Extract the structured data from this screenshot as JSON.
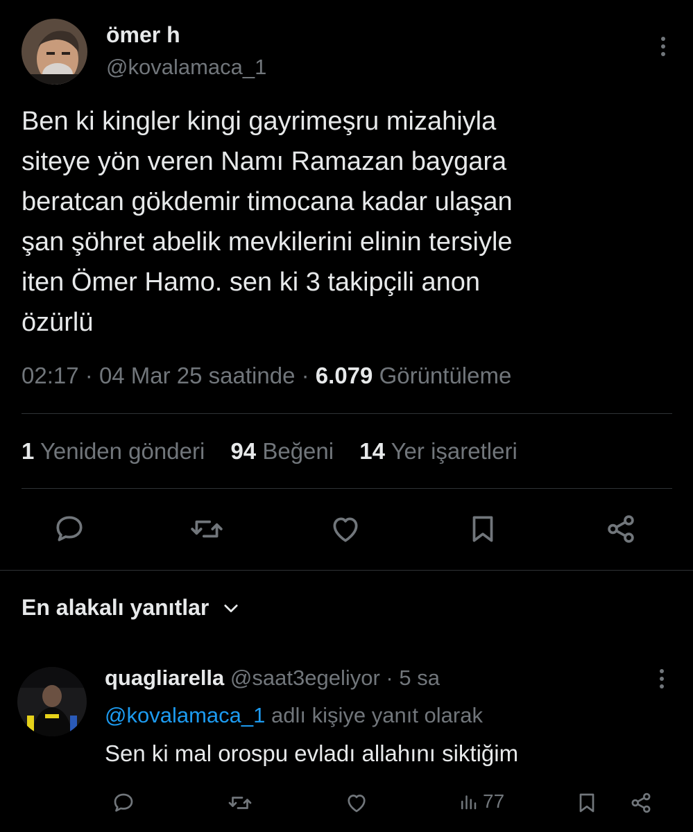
{
  "tweet": {
    "author": {
      "name": "ömer h",
      "handle": "@kovalamaca_1"
    },
    "text": "Ben ki kingler kingi gayrimeşru mizahiyla\nsiteye yön veren Namı Ramazan baygara\nberatcan gökdemir timocana kadar ulaşan\nşan şöhret abelik mevkilerini elinin tersiyle\niten Ömer Hamo. sen ki 3 takipçili anon\nözürlü",
    "time": "02:17",
    "date": "04 Mar 25 saatinde",
    "separator": "·",
    "views_count": "6.079",
    "views_label": "Görüntüleme",
    "stats": {
      "reposts_count": "1",
      "reposts_label": "Yeniden gönderi",
      "likes_count": "94",
      "likes_label": "Beğeni",
      "bookmarks_count": "14",
      "bookmarks_label": "Yer işaretleri"
    },
    "action_icons": [
      "reply-icon",
      "repost-icon",
      "like-icon",
      "bookmark-icon",
      "share-icon"
    ]
  },
  "replies_sort": {
    "label": "En alakalı yanıtlar",
    "icon": "chevron-down-icon"
  },
  "reply": {
    "name": "quagliarella",
    "handle": "@saat3egeliyor",
    "separator": "·",
    "time": "5 sa",
    "reply_to_mention": "@kovalamaca_1",
    "reply_to_suffix": "adlı kişiye yanıt olarak",
    "text": "Sen ki mal orospu evladı allahını siktiğim",
    "views_count": "77",
    "action_icons": [
      "reply-icon",
      "repost-icon",
      "like-icon",
      "views-icon",
      "bookmark-icon",
      "share-icon"
    ]
  },
  "colors": {
    "background": "#000000",
    "text_primary": "#e7e9ea",
    "text_secondary": "#71767b",
    "link": "#1d9bf0",
    "divider": "#2f3336"
  }
}
